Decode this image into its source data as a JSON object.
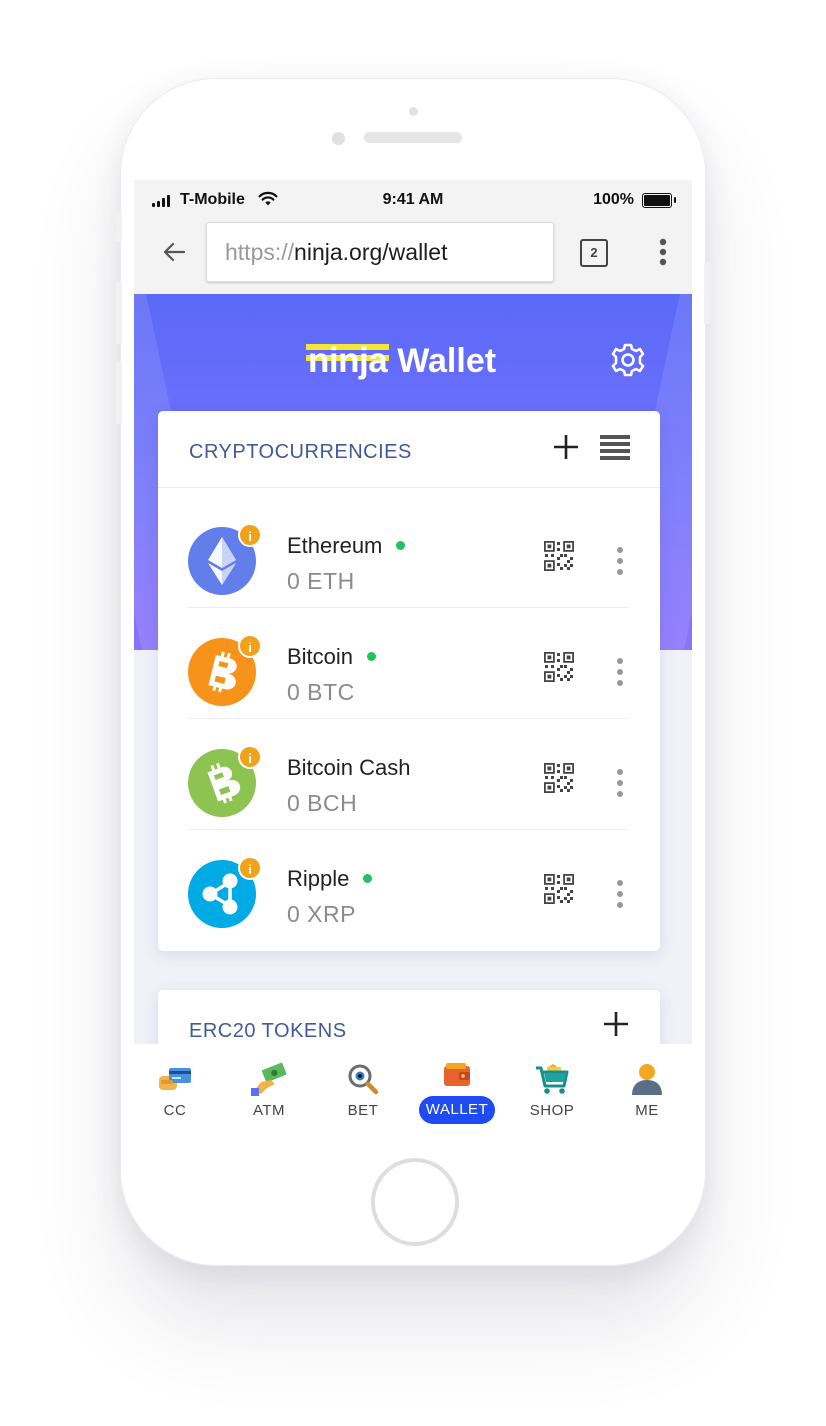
{
  "statusbar": {
    "carrier": "T-Mobile",
    "time": "9:41 AM",
    "battery": "100%"
  },
  "browser": {
    "url_protocol": "https://",
    "url_host": "ninja.org/wallet",
    "tab_count": "2"
  },
  "header": {
    "logo_ninja": "ninja",
    "logo_wallet": "Wallet"
  },
  "crypto_section": {
    "title": "CRYPTOCURRENCIES",
    "coins": [
      {
        "name": "Ethereum",
        "balance": "0 ETH",
        "online": true,
        "color": "#627eea",
        "icon": "ethereum-icon"
      },
      {
        "name": "Bitcoin",
        "balance": "0 BTC",
        "online": true,
        "color": "#f7931a",
        "icon": "bitcoin-icon"
      },
      {
        "name": "Bitcoin Cash",
        "balance": "0 BCH",
        "online": false,
        "color": "#8dc351",
        "icon": "bitcoin-cash-icon"
      },
      {
        "name": "Ripple",
        "balance": "0 XRP",
        "online": true,
        "color": "#00aae4",
        "icon": "ripple-icon"
      }
    ],
    "info_badge": "i"
  },
  "erc20_section": {
    "title": "ERC20 TOKENS"
  },
  "nav": {
    "items": [
      {
        "label": "CC",
        "icon": "credit-card-icon"
      },
      {
        "label": "ATM",
        "icon": "cash-hand-icon"
      },
      {
        "label": "BET",
        "icon": "magnifier-eye-icon"
      },
      {
        "label": "WALLET",
        "icon": "wallet-icon",
        "active": true
      },
      {
        "label": "SHOP",
        "icon": "shopping-cart-icon"
      },
      {
        "label": "ME",
        "icon": "user-icon"
      }
    ],
    "active_color": "#1f4cf2"
  },
  "colors": {
    "accent": "#5b69f8",
    "title_blue": "#415a9a",
    "online_dot": "#1fc55c",
    "info_badge": "#f0a21a"
  }
}
